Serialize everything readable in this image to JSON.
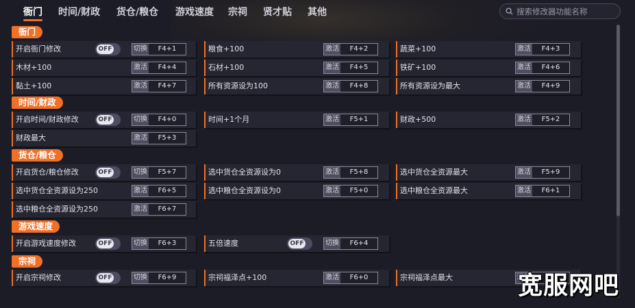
{
  "colors": {
    "accent": "#f07028",
    "background": "#1c1c27",
    "row": "#262633"
  },
  "nav": {
    "tabs": [
      {
        "label": "衙门"
      },
      {
        "label": "时间/财政"
      },
      {
        "label": "货仓/粮仓"
      },
      {
        "label": "游戏速度"
      },
      {
        "label": "宗祠"
      },
      {
        "label": "贤才贴"
      },
      {
        "label": "其他"
      }
    ],
    "search_placeholder": "搜索修改器功能名称"
  },
  "sections": [
    {
      "title": "衙门",
      "items": [
        {
          "label": "开启衙门修改",
          "toggle": "OFF",
          "action": "切换",
          "key": "F4+1"
        },
        {
          "label": "粮食+100",
          "action": "激活",
          "key": "F4+2"
        },
        {
          "label": "蔬菜+100",
          "action": "激活",
          "key": "F4+3"
        },
        {
          "label": "木材+100",
          "action": "激活",
          "key": "F4+4"
        },
        {
          "label": "石材+100",
          "action": "激活",
          "key": "F4+5"
        },
        {
          "label": "铁矿+100",
          "action": "激活",
          "key": "F4+6"
        },
        {
          "label": "黏土+100",
          "action": "激活",
          "key": "F4+7"
        },
        {
          "label": "所有资源设为100",
          "action": "激活",
          "key": "F4+8"
        },
        {
          "label": "所有资源设为最大",
          "action": "激活",
          "key": "F4+9"
        }
      ]
    },
    {
      "title": "时间/财政",
      "items": [
        {
          "label": "开启时间/财政修改",
          "toggle": "OFF",
          "action": "切换",
          "key": "F4+0"
        },
        {
          "label": "时间+1个月",
          "action": "激活",
          "key": "F5+1"
        },
        {
          "label": "财政+500",
          "action": "激活",
          "key": "F5+2"
        },
        {
          "label": "财政最大",
          "action": "激活",
          "key": "F5+3"
        }
      ]
    },
    {
      "title": "货仓/粮仓",
      "items": [
        {
          "label": "开启货仓/粮仓修改",
          "toggle": "OFF",
          "action": "切换",
          "key": "F5+7"
        },
        {
          "label": "选中货仓全资源设为0",
          "action": "激活",
          "key": "F5+8"
        },
        {
          "label": "选中货仓全资源最大",
          "action": "激活",
          "key": "F5+9"
        },
        {
          "label": "选中货仓全资源设为250",
          "action": "激活",
          "key": "F6+5"
        },
        {
          "label": "选中粮仓全资源设为0",
          "action": "激活",
          "key": "F5+0"
        },
        {
          "label": "选中粮仓全资源最大",
          "action": "激活",
          "key": "F6+1"
        },
        {
          "label": "选中粮仓全资源设为250",
          "action": "激活",
          "key": "F6+7"
        }
      ]
    },
    {
      "title": "游戏速度",
      "items": [
        {
          "label": "开启游戏速度修改",
          "toggle": "OFF",
          "action": "切换",
          "key": "F6+3"
        },
        {
          "label": "五倍速度",
          "toggle": "OFF",
          "action": "切换",
          "key": "F6+4"
        }
      ]
    },
    {
      "title": "宗祠",
      "items": [
        {
          "label": "开启宗祠修改",
          "toggle": "OFF",
          "action": "切换",
          "key": "F6+9"
        },
        {
          "label": "宗祠福泽点+100",
          "action": "激活",
          "key": "F6+0"
        },
        {
          "label": "宗祠福泽点最大",
          "action": "激活",
          "key": ""
        }
      ]
    }
  ],
  "watermark": "宽服网吧"
}
